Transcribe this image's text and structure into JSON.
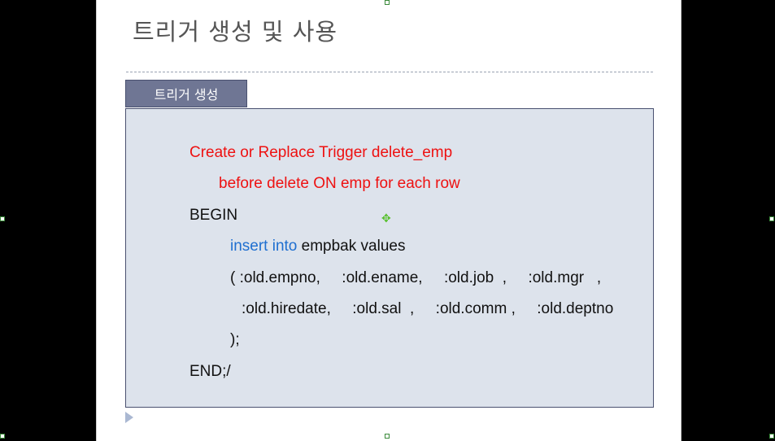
{
  "slide": {
    "title": "트리거 생성 및 사용",
    "tab_label": "트리거 생성"
  },
  "code": {
    "line1": "Create or Replace Trigger delete_emp",
    "line2": "before delete ON emp for each row",
    "line3": "BEGIN",
    "line4_keyword": "insert into",
    "line4_rest": " empbak values",
    "line5": "( :old.empno,     :old.ename,     :old.job  ,     :old.mgr   ,",
    "line6": ":old.hiredate,     :old.sal  ,     :old.comm ,     :old.deptno",
    "line7": ");",
    "line8": "END;/"
  },
  "colors": {
    "keyword_red": "#ee1111",
    "keyword_blue": "#1f6fd0",
    "tab_bg": "#6f7694",
    "box_bg": "#dde3ec"
  },
  "icons": {
    "move_cursor": "move-cursor-icon",
    "selection_handle": "selection-handle-icon",
    "play_marker": "play-marker-icon"
  }
}
